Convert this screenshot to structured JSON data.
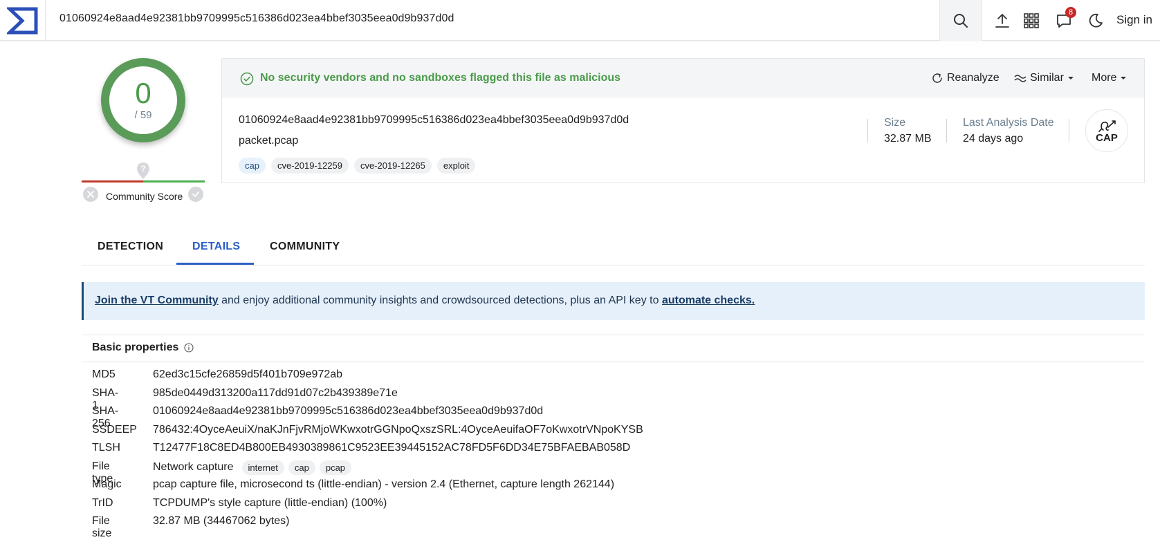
{
  "topbar": {
    "search_value": "01060924e8aad4e92381bb9709995c516386d023ea4bbef3035eea0d9b937d0d",
    "notification_count": "8",
    "signin_label": "Sign in"
  },
  "score": {
    "detections": "0",
    "total": "/ 59",
    "community_label": "Community Score"
  },
  "summary": {
    "status_text": "No security vendors and no sandboxes flagged this file as malicious",
    "actions": {
      "reanalyze": "Reanalyze",
      "similar": "Similar",
      "more": "More"
    },
    "hash": "01060924e8aad4e92381bb9709995c516386d023ea4bbef3035eea0d9b937d0d",
    "filename": "packet.pcap",
    "tags": [
      "cap",
      "cve-2019-12259",
      "cve-2019-12265",
      "exploit"
    ],
    "size_label": "Size",
    "size_value": "32.87 MB",
    "date_label": "Last Analysis Date",
    "date_value": "24 days ago",
    "file_type_icon": "CAP"
  },
  "tabs": [
    "DETECTION",
    "DETAILS",
    "COMMUNITY"
  ],
  "active_tab": "DETAILS",
  "banner": {
    "link1": "Join the VT Community",
    "middle": " and enjoy additional community insights and crowdsourced detections, plus an API key to ",
    "link2": "automate checks."
  },
  "basic_properties": {
    "title": "Basic properties",
    "rows": [
      {
        "key": "MD5",
        "value": "62ed3c15cfe26859d5f401b709e972ab"
      },
      {
        "key": "SHA-1",
        "value": "985de0449d313200a117dd91d07c2b439389e71e"
      },
      {
        "key": "SHA-256",
        "value": "01060924e8aad4e92381bb9709995c516386d023ea4bbef3035eea0d9b937d0d"
      },
      {
        "key": "SSDEEP",
        "value": "786432:4OyceAeuiX/naKJnFjvRMjoWKwxotrGGNpoQxszSRL:4OyceAeuifaOF7oKwxotrVNpoKYSB"
      },
      {
        "key": "TLSH",
        "value": "T12477F18C8ED4B800EB4930389861C9523EE39445152AC78FD5F6DD34E75BFAEBAB058D"
      },
      {
        "key": "File type",
        "value": "Network capture"
      },
      {
        "key": "Magic",
        "value": "pcap capture file, microsecond ts (little-endian) - version 2.4 (Ethernet, capture length 262144)"
      },
      {
        "key": "TrID",
        "value": "TCPDUMP's style capture (little-endian) (100%)"
      },
      {
        "key": "File size",
        "value": "32.87 MB (34467062 bytes)"
      }
    ],
    "file_type_tags": [
      "internet",
      "cap",
      "pcap"
    ]
  },
  "colors": {
    "accent_blue": "#2c5ec5",
    "safe_green": "#4a9b4a",
    "banner_bg": "#e6f0fb",
    "badge_red": "#c62828"
  }
}
